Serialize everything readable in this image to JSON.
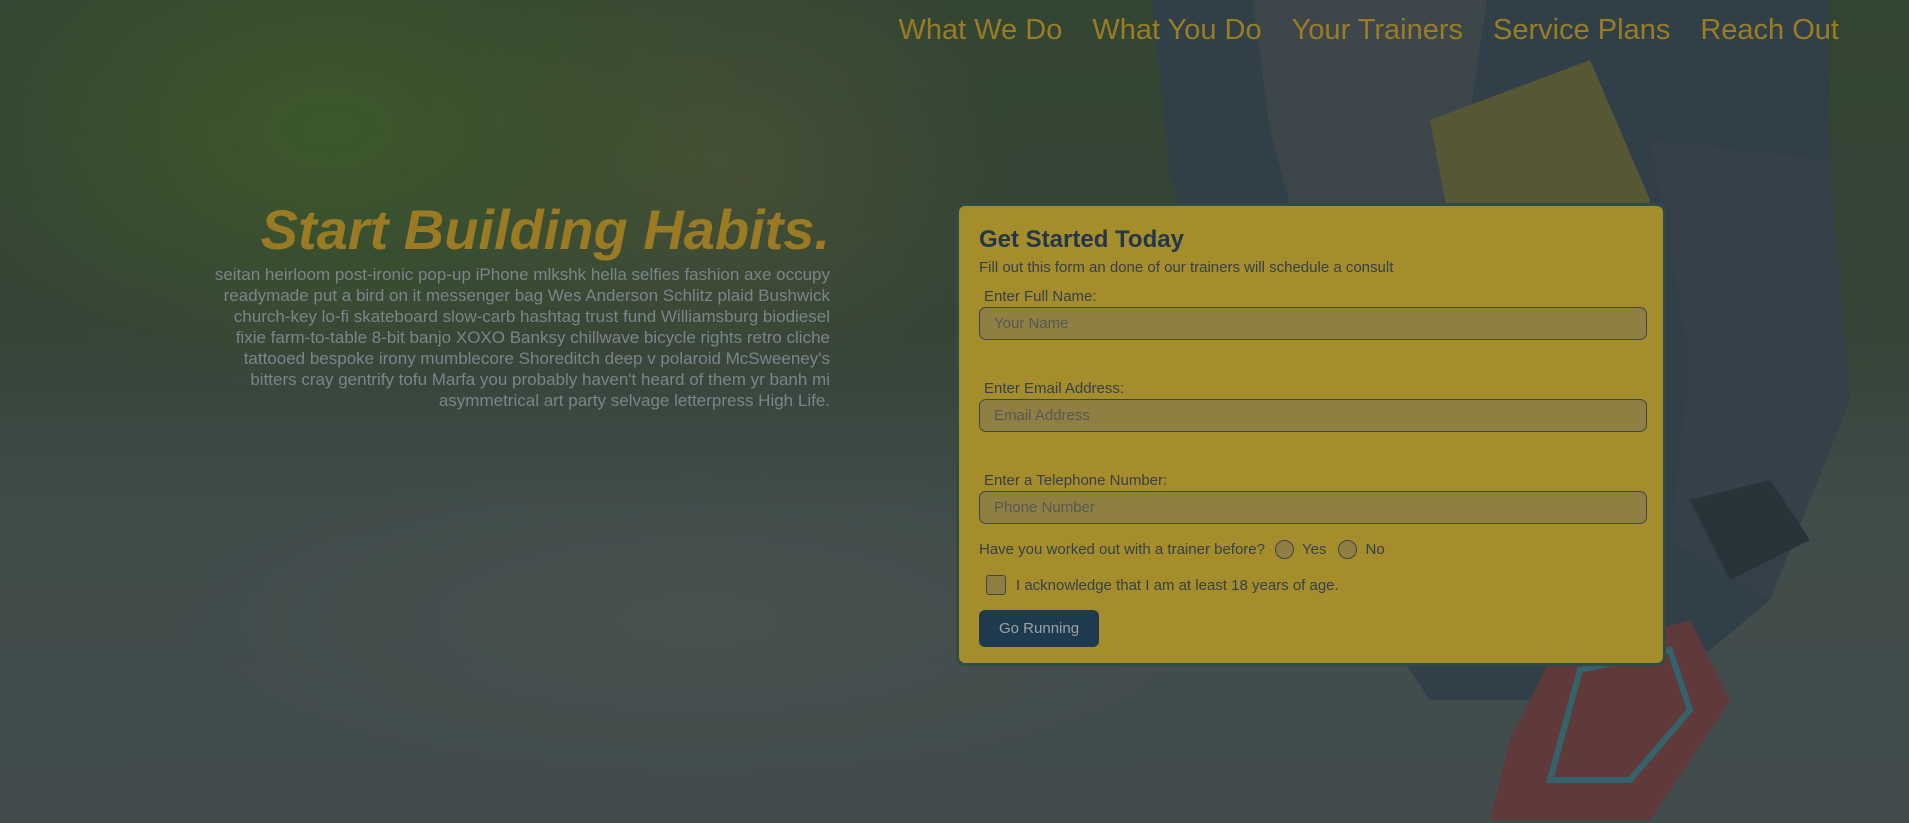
{
  "nav": {
    "items": [
      {
        "label": "What We Do"
      },
      {
        "label": "What You Do"
      },
      {
        "label": "Your Trainers"
      },
      {
        "label": "Service Plans"
      },
      {
        "label": "Reach Out"
      }
    ]
  },
  "hero": {
    "title": "Start Building Habits.",
    "body": "seitan heirloom post-ironic pop-up iPhone mlkshk hella selfies fashion axe occupy readymade put a bird on it messenger bag Wes Anderson Schlitz plaid Bushwick church-key lo-fi skateboard slow-carb hashtag trust fund Williamsburg biodiesel fixie farm-to-table 8-bit banjo XOXO Banksy chillwave bicycle rights retro cliche tattooed bespoke irony mumblecore Shoreditch deep v polaroid McSweeney's bitters cray gentrify tofu Marfa you probably haven't heard of them yr banh mi asymmetrical art party selvage letterpress High Life."
  },
  "form": {
    "title": "Get Started Today",
    "subtitle": "Fill out this form an done of our trainers will schedule a consult",
    "name": {
      "label": "Enter Full Name:",
      "placeholder": "Your Name",
      "value": ""
    },
    "email": {
      "label": "Enter Email Address:",
      "placeholder": "Email Address",
      "value": ""
    },
    "phone": {
      "label": "Enter a Telephone Number:",
      "placeholder": "Phone Number",
      "value": ""
    },
    "trainer_question": {
      "label": "Have you worked out with a trainer before?",
      "options": [
        "Yes",
        "No"
      ]
    },
    "age_ack": {
      "label": "I acknowledge that I am at least 18 years of age."
    },
    "submit_label": "Go Running"
  },
  "colors": {
    "accent_gold": "#9a7d22",
    "card_bg": "#a68d2c",
    "button_bg": "#1e3a4e",
    "card_border": "#2f4a47"
  }
}
